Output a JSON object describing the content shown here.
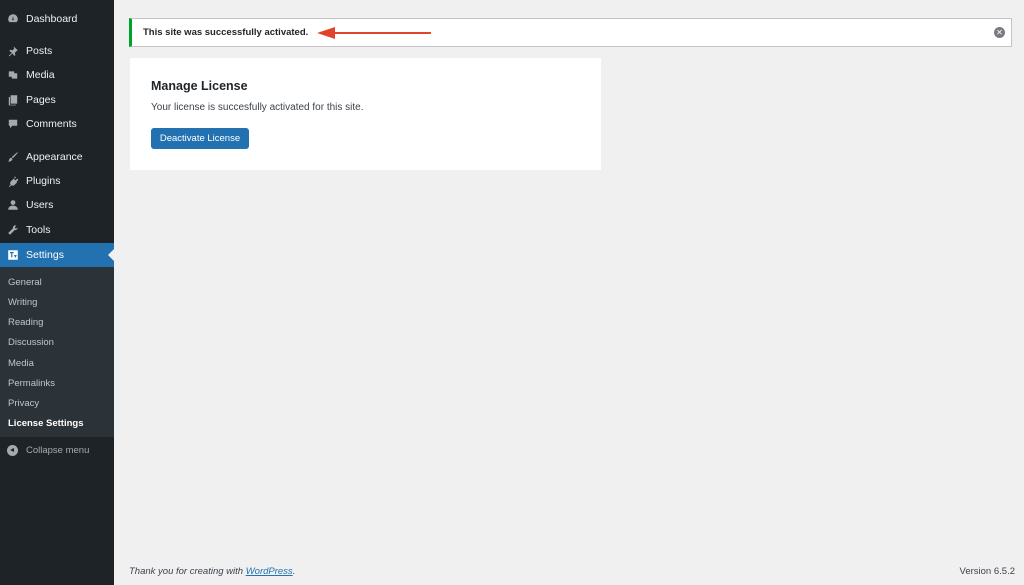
{
  "sidebar": {
    "items": [
      {
        "label": "Dashboard",
        "icon": "dashboard-icon"
      },
      {
        "label": "Posts",
        "icon": "pushpin-icon"
      },
      {
        "label": "Media",
        "icon": "media-icon"
      },
      {
        "label": "Pages",
        "icon": "pages-icon"
      },
      {
        "label": "Comments",
        "icon": "comment-icon"
      },
      {
        "label": "Appearance",
        "icon": "paintbrush-icon"
      },
      {
        "label": "Plugins",
        "icon": "plug-icon"
      },
      {
        "label": "Users",
        "icon": "user-icon"
      },
      {
        "label": "Tools",
        "icon": "wrench-icon"
      },
      {
        "label": "Settings",
        "icon": "settings-icon",
        "active": true
      }
    ],
    "submenu": [
      "General",
      "Writing",
      "Reading",
      "Discussion",
      "Media",
      "Permalinks",
      "Privacy",
      "License Settings"
    ],
    "current_submenu": "License Settings",
    "collapse_label": "Collapse menu"
  },
  "notice": {
    "message": "This site was successfully activated.",
    "status_color": "#00a32a"
  },
  "license": {
    "title": "Manage License",
    "description": "Your license is succesfully activated for this site.",
    "button_label": "Deactivate License"
  },
  "annotation": {
    "arrow_color": "#e0442b"
  },
  "footer": {
    "thanks_prefix": "Thank you for creating with ",
    "link_text": "WordPress",
    "thanks_suffix": ".",
    "version": "Version 6.5.2"
  },
  "colors": {
    "accent": "#2271b1",
    "sidebar_bg": "#1d2327",
    "submenu_bg": "#2c3338"
  }
}
